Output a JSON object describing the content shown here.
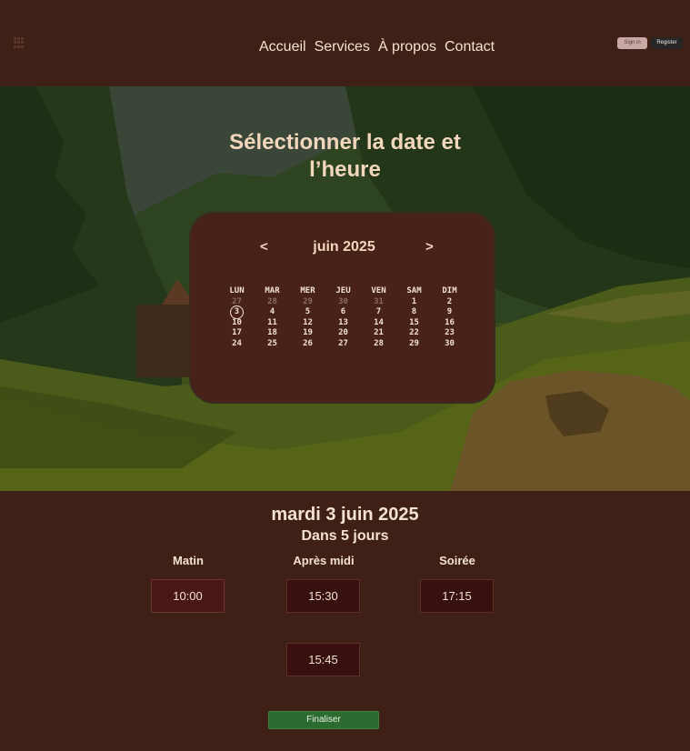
{
  "header": {
    "nav": [
      "Accueil",
      "Services",
      "À propos",
      "Contact"
    ],
    "signin_label": "Sign in",
    "register_label": "Register"
  },
  "hero": {
    "title_line1": "Sélectionner la date et",
    "title_line2": "l’heure"
  },
  "calendar": {
    "prev_label": "<",
    "next_label": ">",
    "month_label": "juin 2025",
    "weekdays": [
      "LUN",
      "MAR",
      "MER",
      "JEU",
      "VEN",
      "SAM",
      "DIM"
    ],
    "weeks": [
      [
        "27",
        "28",
        "29",
        "30",
        "31",
        "1",
        "2"
      ],
      [
        "3",
        "4",
        "5",
        "6",
        "7",
        "8",
        "9"
      ],
      [
        "10",
        "11",
        "12",
        "13",
        "14",
        "15",
        "16"
      ],
      [
        "17",
        "18",
        "19",
        "20",
        "21",
        "22",
        "23"
      ],
      [
        "24",
        "25",
        "26",
        "27",
        "28",
        "29",
        "30"
      ]
    ],
    "selected_day": "3"
  },
  "selection": {
    "date_label": "mardi 3 juin 2025",
    "relative_label": "Dans 5 jours"
  },
  "slots": {
    "morning_label": "Matin",
    "afternoon_label": "Après midi",
    "evening_label": "Soirée",
    "morning": [
      "10:00"
    ],
    "afternoon": [
      "15:30",
      "15:45"
    ],
    "evening": [
      "17:15"
    ]
  },
  "finalize_label": "Finaliser"
}
